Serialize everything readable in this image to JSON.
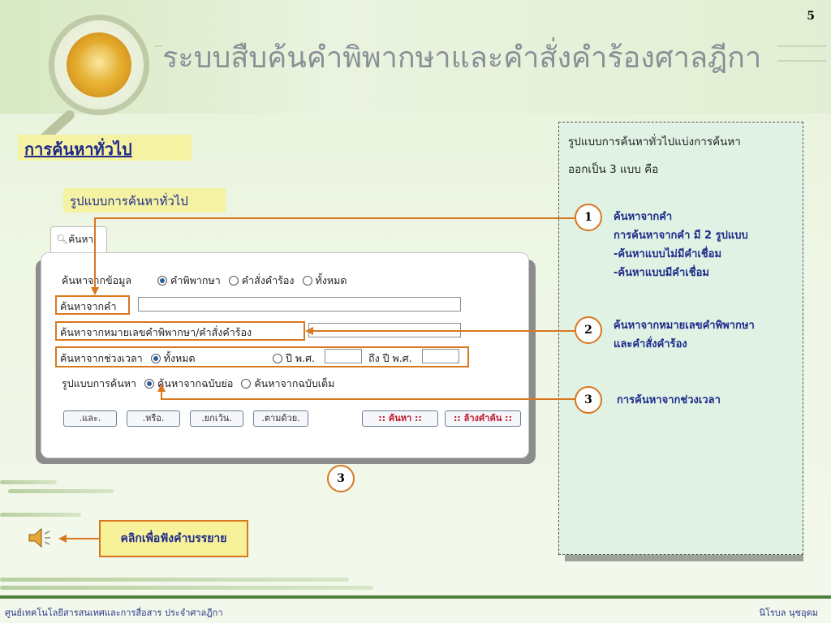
{
  "header": {
    "title": "ระบบสืบค้นคำพิพากษาและคำสั่งคำร้องศาลฎีกา",
    "slide_number": "5",
    "logo_icon": "court-seal-icon"
  },
  "section": {
    "title": "การค้นหาทั่วไป",
    "subtitle": "รูปแบบการค้นหาทั่วไป"
  },
  "search_form": {
    "tab_label": "ค้นหา",
    "tab_icon": "magnifier-icon",
    "source_label": "ค้นหาจากข้อมูล",
    "source_options": [
      "คำพิพากษา",
      "คำสั่งคำร้อง",
      "ทั้งหมด"
    ],
    "source_selected": "คำพิพากษา",
    "word_label": "ค้นหาจากคำ",
    "word_value": "",
    "number_label": "ค้นหาจากหมายเลขคำพิพากษา/คำสั่งคำร้อง",
    "number_value": "",
    "period_label": "ค้นหาจากช่วงเวลา",
    "period_all": "ทั้งหมด",
    "period_year": "ปี พ.ศ.",
    "period_to_year": "ถึง ปี พ.ศ.",
    "period_selected": "ทั้งหมด",
    "format_label": "รูปแบบการค้นหา",
    "format_options": [
      "ค้นหาจากฉบับย่อ",
      "ค้นหาจากฉบับเต็ม"
    ],
    "format_selected": "ค้นหาจากฉบับย่อ",
    "buttons": [
      ".และ.",
      ".หรือ.",
      ".ยกเว้น.",
      ".ตามด้วย."
    ],
    "search_button": ":: ค้นหา ::",
    "clear_button": ":: ล้างคำค้น ::",
    "marker_number": "3"
  },
  "callout": {
    "intro_line1": "รูปแบบการค้นหาทั่วไปแบ่งการค้นหา",
    "intro_line2": "ออกเป็น 3 แบบ คือ",
    "items": [
      {
        "number": "1",
        "lines": [
          "ค้นหาจากคำ",
          "การค้นหาจากคำ มี 2 รูปแบบ",
          "-ค้นหาแบบไม่มีคำเชื่อม",
          "-ค้นหาแบบมีคำเชื่อม"
        ]
      },
      {
        "number": "2",
        "lines": [
          "ค้นหาจากหมายเลขคำพิพากษา",
          "และคำสั่งคำร้อง"
        ]
      },
      {
        "number": "3",
        "lines": [
          "การค้นหาจากช่วงเวลา"
        ]
      }
    ]
  },
  "narration": {
    "label": "คลิกเพื่อฟังคำบรรยาย",
    "icon": "speaker-icon"
  },
  "footer": {
    "left": "ศูนย์เทคโนโลยีสารสนเทศและการสื่อสาร ประจำศาลฎีกา",
    "right": "นิโรบล นุชอุดม"
  },
  "colors": {
    "accent_orange": "#d9771f",
    "title_blue": "#1f2a8a",
    "highlight_yellow": "#f5f2a3",
    "callout_green": "#dff2e4"
  }
}
